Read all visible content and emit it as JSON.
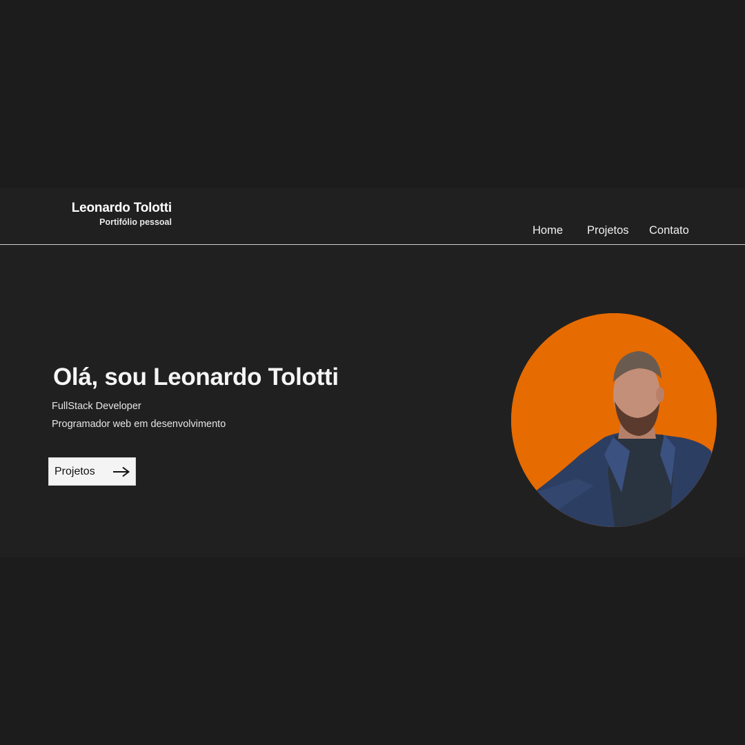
{
  "header": {
    "brand_name": "Leonardo Tolotti",
    "brand_subtitle": "Portifólio pessoal",
    "nav": {
      "home": "Home",
      "projects": "Projetos",
      "contact": "Contato"
    }
  },
  "hero": {
    "title": "Olá, sou Leonardo Tolotti",
    "line_1": "FullStack Developer",
    "line_2": "Programador web em desenvolvimento",
    "cta_label": "Projetos",
    "cta_icon": "arrow-right-icon"
  },
  "colors": {
    "background": "#1c1c1c",
    "section": "#202020",
    "accent": "#e66b00",
    "button_bg": "#f4f4f4"
  }
}
